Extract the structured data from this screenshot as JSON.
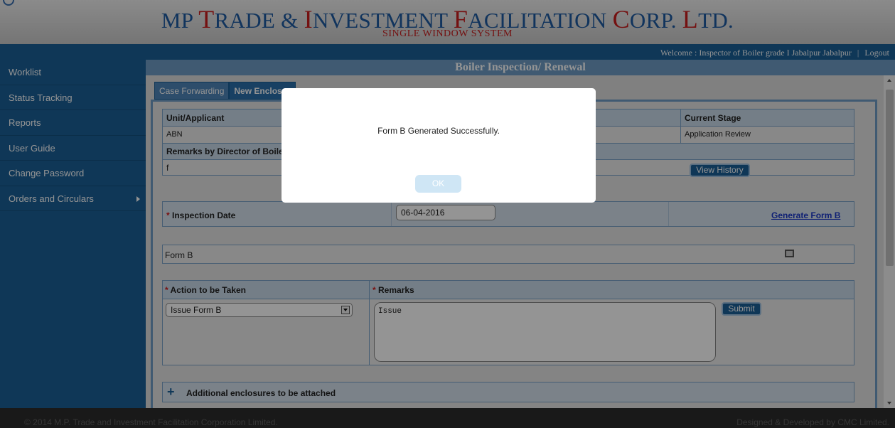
{
  "header": {
    "title_parts": [
      "MP ",
      "T",
      "RADE & ",
      "I",
      "NVESTMENT ",
      "F",
      "ACILITATION ",
      "C",
      "ORP. ",
      "L",
      "TD."
    ],
    "subtitle": "SINGLE WINDOW SYSTEM",
    "welcome_text": "Welcome : Inspector of Boiler grade I Jabalpur Jabalpur",
    "separator": "|",
    "logout_label": "Logout"
  },
  "sidebar": {
    "items": [
      {
        "label": "Worklist"
      },
      {
        "label": "Status Tracking"
      },
      {
        "label": "Reports"
      },
      {
        "label": "User Guide"
      },
      {
        "label": "Change Password"
      },
      {
        "label": "Orders and Circulars"
      }
    ]
  },
  "main": {
    "page_title": "Boiler Inspection/ Renewal",
    "tabs": [
      {
        "label": "Case Forwarding"
      },
      {
        "label": "New Enclosur"
      }
    ],
    "info": {
      "unit_header": "Unit/Applicant",
      "unit_value": "ABN",
      "stage_header": "Current Stage",
      "stage_value": "Application Review",
      "remarks_header": "Remarks by Director of Boiler",
      "remarks_value": "f",
      "history_button": "View History"
    },
    "inspection": {
      "label_required": "*",
      "label": " Inspection Date",
      "date_value": "06-04-2016",
      "generate_link": "Generate Form B"
    },
    "form_b": {
      "label": "Form B"
    },
    "action": {
      "action_header": " Action to be Taken",
      "remarks_header": " Remarks",
      "required_mark": "*",
      "selected_action": "Issue Form B",
      "remarks_value": "Issue",
      "submit_label": "Submit"
    },
    "enclosures": {
      "plus": "+",
      "label": "Additional enclosures to be attached"
    }
  },
  "footer": {
    "left": "© 2014 M.P. Trade and Investment Facilitation Corporation Limited.",
    "right": "Designed & Developed by CMC Limited."
  },
  "modal": {
    "message": "Form B Generated Successfully.",
    "ok_label": "OK"
  },
  "colors": {
    "brand_blue": "#1a5f96",
    "header_red": "#c81e1e",
    "header_blue": "#1e5aa0"
  }
}
